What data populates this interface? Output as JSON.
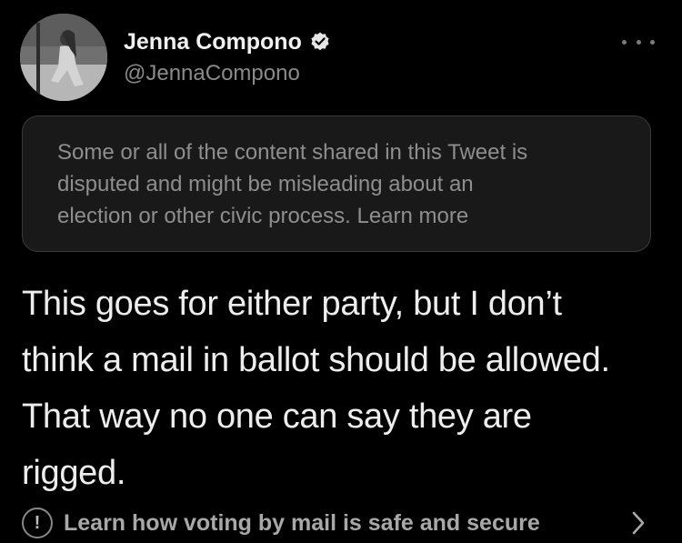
{
  "author": {
    "display_name": "Jenna Compono",
    "handle": "@JennaCompono",
    "verified_icon": "verified-badge-icon",
    "avatar_icon": "avatar-photo"
  },
  "menu": {
    "more_icon": "more-options-icon"
  },
  "notice": {
    "line1": "Some or all of the content shared in this Tweet is",
    "line2": "disputed and might be misleading about an",
    "line3_prefix": "election or other civic process. ",
    "learn_more": "Learn more"
  },
  "tweet": {
    "line1": "This goes for either party, but I don’t",
    "line2": "think a mail in ballot should be allowed.",
    "line3": "That way no one can say they are",
    "line4": "rigged."
  },
  "info_link": {
    "icon": "alert-circle-icon",
    "icon_glyph": "!",
    "label": "Learn how voting by mail is safe and secure",
    "chevron_icon": "chevron-right-icon"
  },
  "colors": {
    "background": "#000000",
    "notice_background": "#191919",
    "primary_text": "#ededed",
    "secondary_text": "#8a8a8a"
  }
}
